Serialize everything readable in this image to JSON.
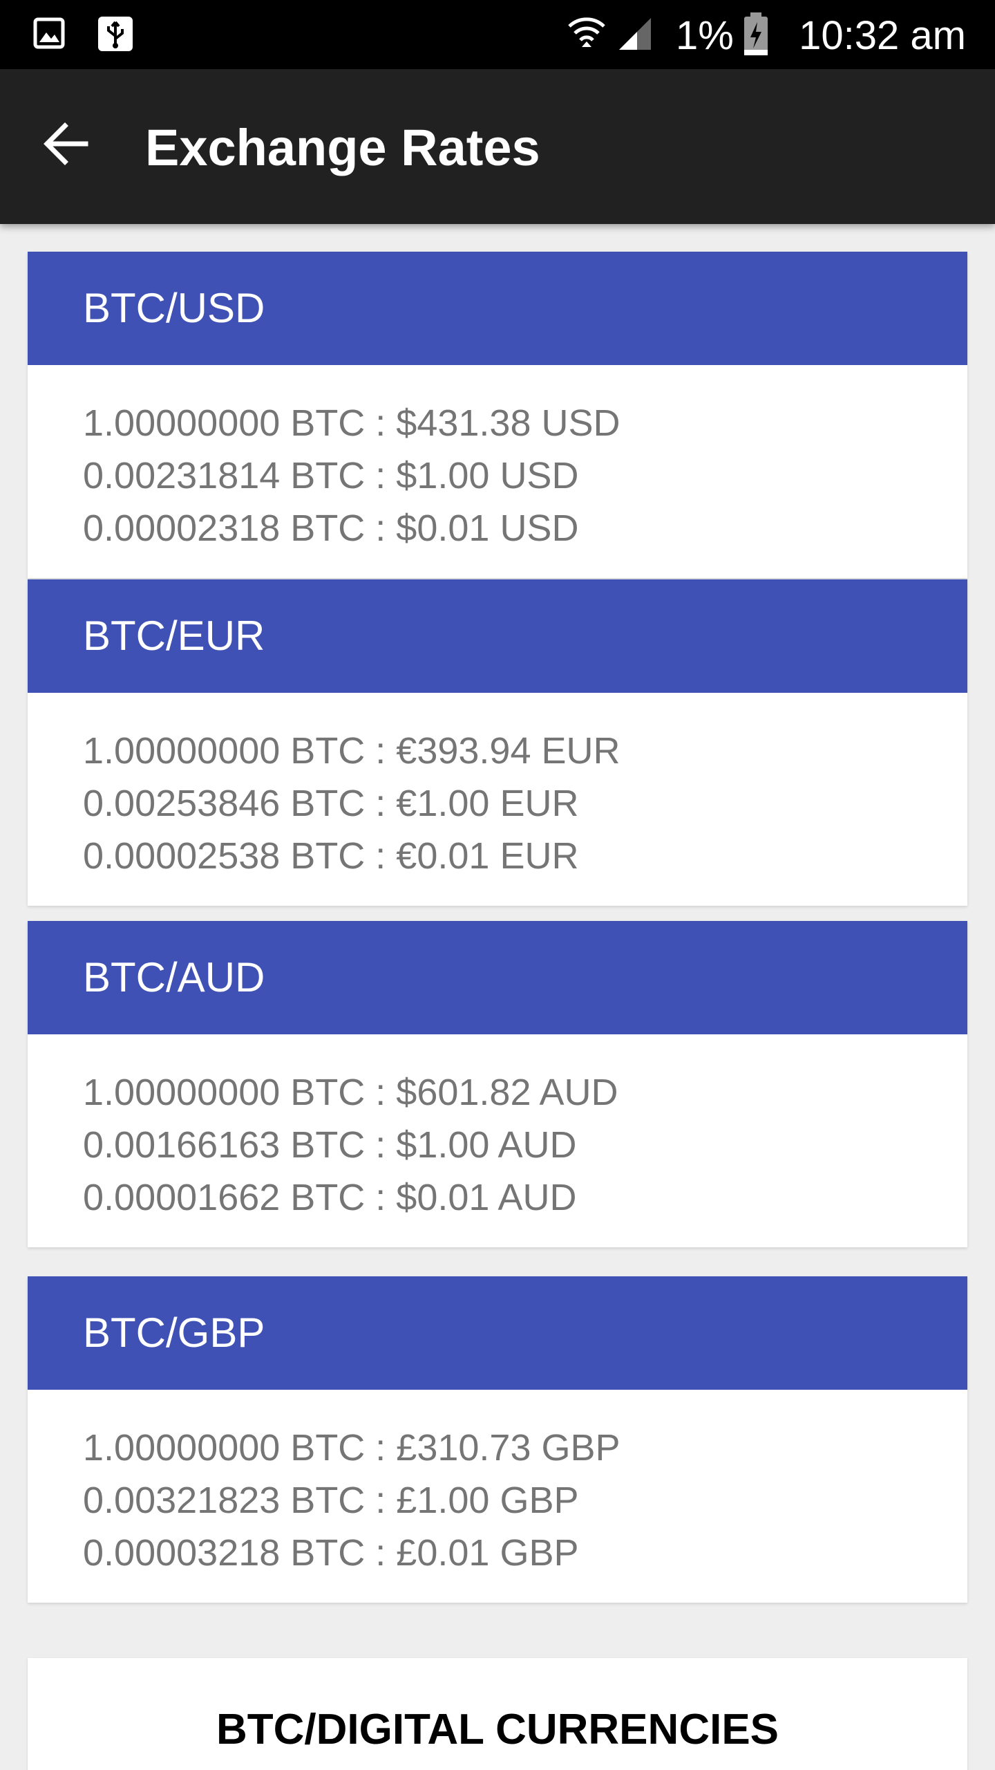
{
  "status_bar": {
    "battery_percent": "1%",
    "time": "10:32 am",
    "icons": [
      "image-icon",
      "usb-icon",
      "wifi-icon",
      "signal-icon",
      "battery-charging-icon"
    ]
  },
  "app_bar": {
    "title": "Exchange Rates",
    "back_icon": "back-arrow-icon"
  },
  "cards": [
    {
      "pair": "BTC/USD",
      "rates": [
        "1.00000000 BTC : $431.38 USD",
        "0.00231814 BTC : $1.00 USD",
        "0.00002318 BTC : $0.01 USD"
      ]
    },
    {
      "pair": "BTC/EUR",
      "rates": [
        "1.00000000 BTC : €393.94 EUR",
        "0.00253846 BTC : €1.00 EUR",
        "0.00002538 BTC : €0.01 EUR"
      ]
    },
    {
      "pair": "BTC/AUD",
      "rates": [
        "1.00000000 BTC : $601.82 AUD",
        "0.00166163 BTC : $1.00 AUD",
        "0.00001662 BTC : $0.01 AUD"
      ]
    },
    {
      "pair": "BTC/GBP",
      "rates": [
        "1.00000000 BTC : £310.73 GBP",
        "0.00321823 BTC : £1.00 GBP",
        "0.00003218 BTC : £0.01 GBP"
      ]
    }
  ],
  "digital_currencies": {
    "title": "BTC/DIGITAL CURRENCIES"
  },
  "colors": {
    "status_bar": "#000000",
    "app_bar": "#212121",
    "card_header": "#3f51b5",
    "background": "#eeeeee",
    "rate_text": "#757575"
  }
}
